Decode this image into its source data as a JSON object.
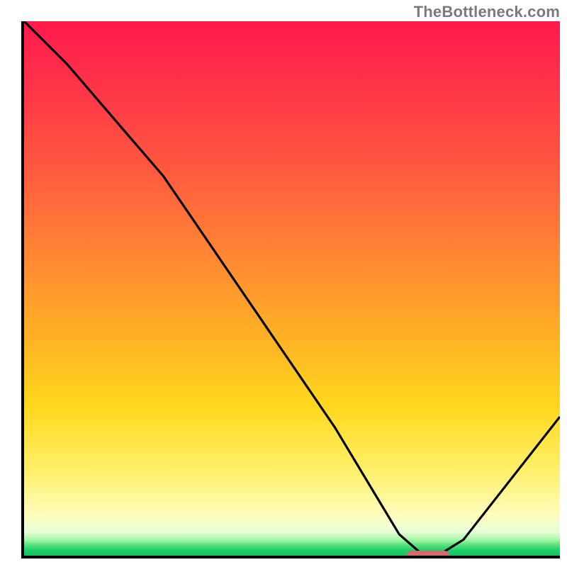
{
  "watermark": "TheBottleneck.com",
  "colors": {
    "axis": "#000000",
    "curve": "#000000",
    "marker": "#d56a6e",
    "watermark_text": "#7a7a7a"
  },
  "chart_data": {
    "type": "line",
    "title": "",
    "xlabel": "",
    "ylabel": "",
    "xlim": [
      0,
      100
    ],
    "ylim": [
      0,
      100
    ],
    "grid": false,
    "series": [
      {
        "name": "bottleneck-curve",
        "x": [
          0,
          8,
          20,
          26,
          58,
          70,
          74,
          78,
          82,
          100
        ],
        "values": [
          100,
          92,
          78,
          71,
          24,
          4,
          0.5,
          0.5,
          3,
          26
        ]
      }
    ],
    "marker": {
      "name": "optimal-zone",
      "x_start": 71,
      "x_end": 79,
      "y": 0.5
    },
    "background_gradient": {
      "stops": [
        {
          "pos": 0,
          "color": "#ff1a4b"
        },
        {
          "pos": 0.45,
          "color": "#ff8a32"
        },
        {
          "pos": 0.72,
          "color": "#ffd81c"
        },
        {
          "pos": 0.92,
          "color": "#fffcb8"
        },
        {
          "pos": 1.0,
          "color": "#12c45f"
        }
      ]
    }
  }
}
